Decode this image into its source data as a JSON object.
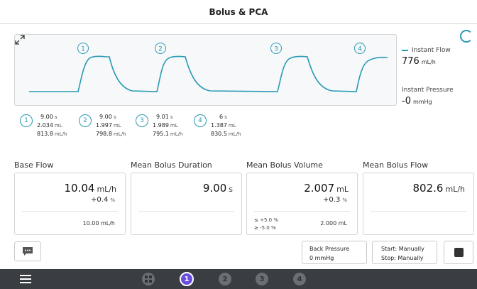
{
  "title": "Bolus & PCA",
  "chart": {
    "markers": [
      "1",
      "2",
      "3",
      "4"
    ],
    "expand_icon": "expand-icon",
    "line_color": "#2a9ab5"
  },
  "legend": {
    "flow_label": "Instant Flow",
    "flow_value": "776",
    "flow_unit": "mL/h",
    "pressure_label": "Instant Pressure",
    "pressure_value": "-0",
    "pressure_unit": "mmHg"
  },
  "boluses": [
    {
      "num": "1",
      "duration": "9.00",
      "duration_unit": "s",
      "volume": "2.034",
      "volume_unit": "mL",
      "flow": "813.8",
      "flow_unit": "mL/h"
    },
    {
      "num": "2",
      "duration": "9.00",
      "duration_unit": "s",
      "volume": "1.997",
      "volume_unit": "mL",
      "flow": "798.8",
      "flow_unit": "mL/h"
    },
    {
      "num": "3",
      "duration": "9.01",
      "duration_unit": "s",
      "volume": "1.989",
      "volume_unit": "mL",
      "flow": "795.1",
      "flow_unit": "mL/h"
    },
    {
      "num": "4",
      "duration": "6",
      "duration_unit": "s",
      "volume": "1.387",
      "volume_unit": "mL",
      "flow": "830.5",
      "flow_unit": "mL/h"
    }
  ],
  "cards": {
    "base_flow": {
      "title": "Base Flow",
      "value": "10.04",
      "unit": "mL/h",
      "delta": "+0.4",
      "delta_unit": "%",
      "foot": "10.00  mL/h"
    },
    "mean_duration": {
      "title": "Mean Bolus Duration",
      "value": "9.00",
      "unit": "s"
    },
    "mean_volume": {
      "title": "Mean Bolus Volume",
      "value": "2.007",
      "unit": "mL",
      "delta": "+0.3",
      "delta_unit": "%",
      "limit_hi": "≤ +5.0 %",
      "limit_lo": "≥ -5.0 %",
      "foot": "2.000  mL"
    },
    "mean_flow": {
      "title": "Mean Bolus Flow",
      "value": "802.6",
      "unit": "mL/h"
    }
  },
  "buttons": {
    "message_icon": "message-icon",
    "back_pressure_label": "Back Pressure",
    "back_pressure_value": "0 mmHg",
    "start_label": "Start: Manually",
    "stop_label": "Stop: Manually",
    "stop_icon": "stop-icon"
  },
  "nav": {
    "menu_icon": "hamburger-icon",
    "grid_icon": "grid-icon",
    "pages": [
      "1",
      "2",
      "3",
      "4"
    ],
    "active_page": "1",
    "accent": "#6a4ce0"
  }
}
